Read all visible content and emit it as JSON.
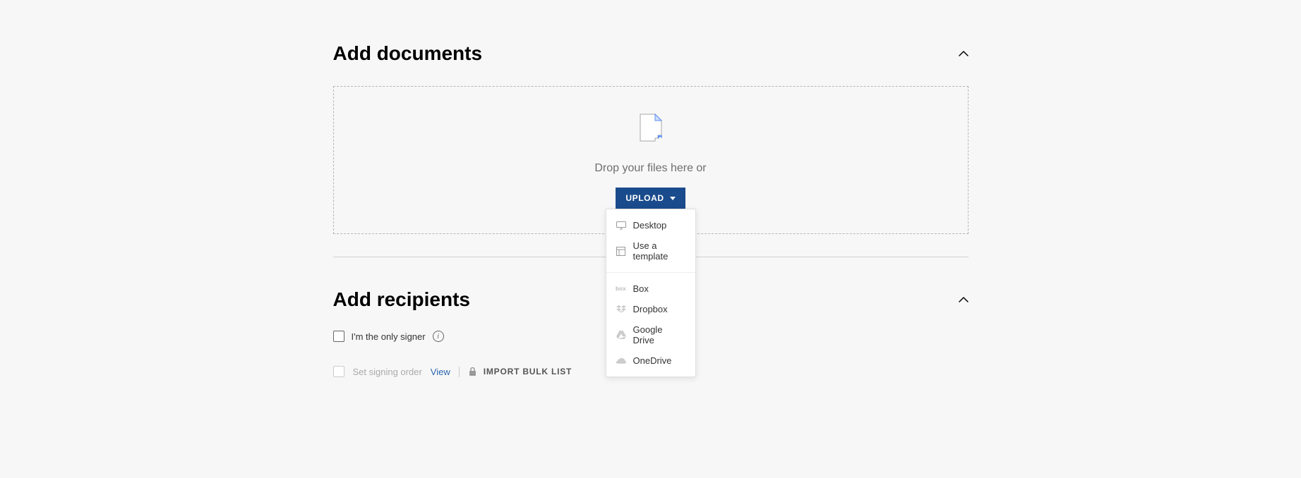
{
  "sections": {
    "add_documents": {
      "title": "Add documents",
      "drop_text": "Drop your files here or",
      "upload_label": "UPLOAD",
      "menu": {
        "group1": [
          {
            "label": "Desktop",
            "icon": "desktop-icon"
          },
          {
            "label": "Use a template",
            "icon": "template-icon"
          }
        ],
        "group2": [
          {
            "label": "Box",
            "icon": "box-icon"
          },
          {
            "label": "Dropbox",
            "icon": "dropbox-icon"
          },
          {
            "label": "Google Drive",
            "icon": "googledrive-icon"
          },
          {
            "label": "OneDrive",
            "icon": "onedrive-icon"
          }
        ]
      }
    },
    "add_recipients": {
      "title": "Add recipients",
      "only_signer_label": "I'm the only signer",
      "set_signing_order_label": "Set signing order",
      "view_label": "View",
      "import_bulk_label": "IMPORT BULK LIST"
    }
  }
}
